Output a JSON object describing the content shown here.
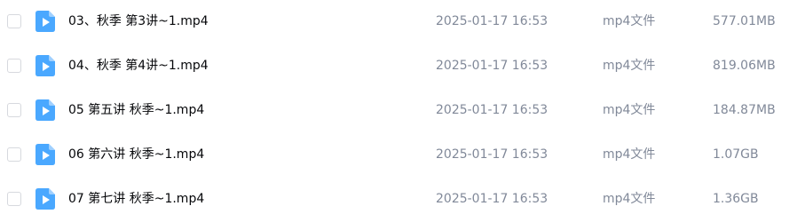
{
  "colors": {
    "icon_blue": "#4aa8ff",
    "name_text": "#06070a",
    "meta_text": "#818999",
    "checkbox_border": "#d7d9de"
  },
  "files": [
    {
      "icon": "video-file-icon",
      "name": "03、秋季 第3讲~1.mp4",
      "modified": "2025-01-17 16:53",
      "type": "mp4文件",
      "size": "577.01MB"
    },
    {
      "icon": "video-file-icon",
      "name": "04、秋季 第4讲~1.mp4",
      "modified": "2025-01-17 16:53",
      "type": "mp4文件",
      "size": "819.06MB"
    },
    {
      "icon": "video-file-icon",
      "name": "05 第五讲 秋季~1.mp4",
      "modified": "2025-01-17 16:53",
      "type": "mp4文件",
      "size": "184.87MB"
    },
    {
      "icon": "video-file-icon",
      "name": "06 第六讲 秋季~1.mp4",
      "modified": "2025-01-17 16:53",
      "type": "mp4文件",
      "size": "1.07GB"
    },
    {
      "icon": "video-file-icon",
      "name": "07 第七讲 秋季~1.mp4",
      "modified": "2025-01-17 16:53",
      "type": "mp4文件",
      "size": "1.36GB"
    }
  ]
}
